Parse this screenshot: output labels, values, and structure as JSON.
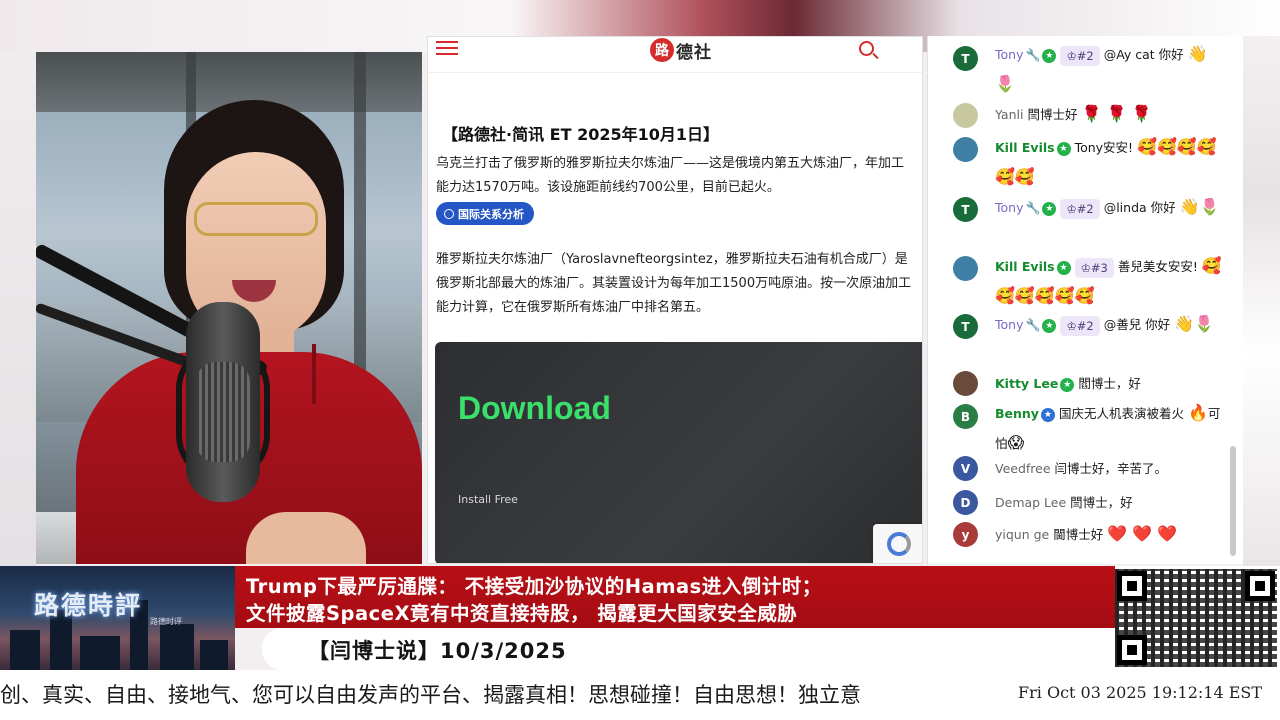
{
  "article": {
    "logo_text": "德社",
    "logo_badge": "路",
    "title": "【路德社·简讯 ET 2025年10月1日】",
    "paragraph1": "乌克兰打击了俄罗斯的雅罗斯拉夫尔炼油厂——这是俄境内第五大炼油厂，年加工能力达1570万吨。该设施距前线约700公里，目前已起火。",
    "tag": "国际关系分析",
    "paragraph2": "雅罗斯拉夫尔炼油厂（Yaroslavnefteorgsintez，雅罗斯拉夫石油有机合成厂）是俄罗斯北部最大的炼油厂。其装置设计为每年加工1500万吨原油。按一次原油加工能力计算，它在俄罗斯所有炼油厂中排名第五。",
    "ad": {
      "headline": "Download",
      "sub": "Install Free"
    }
  },
  "chat": {
    "messages": [
      {
        "avatar": "T",
        "avatar_color": "#1a6b3a",
        "user": "Tony",
        "rank": "♔#2",
        "text": "@Ay cat 你好",
        "emoji": "👋🌷"
      },
      {
        "avatar": "",
        "avatar_color": "#c8c8a0",
        "user": "Yanli",
        "text": "閆博士好",
        "emoji": "🌹 🌹 🌹"
      },
      {
        "avatar": "",
        "avatar_color": "#3f7fa6",
        "user": "Kill Evils",
        "text": "Tony安安!",
        "emoji": "🥰🥰🥰🥰🥰🥰"
      },
      {
        "avatar": "T",
        "avatar_color": "#1a6b3a",
        "user": "Tony",
        "rank": "♔#2",
        "text": "@linda 你好",
        "emoji": "👋🌷"
      },
      {
        "avatar": "",
        "avatar_color": "#3f7fa6",
        "user": "Kill Evils",
        "rank": "♔#3",
        "text": "善兒美女安安!",
        "emoji": "🥰🥰🥰🥰🥰🥰"
      },
      {
        "avatar": "T",
        "avatar_color": "#1a6b3a",
        "user": "Tony",
        "rank": "♔#2",
        "text": "@善兒 你好",
        "emoji": "👋🌷"
      },
      {
        "avatar": "",
        "avatar_color": "#6a4a3a",
        "user": "Kitty Lee",
        "text": "閻博士，好"
      },
      {
        "avatar": "B",
        "avatar_color": "#2b7d46",
        "user": "Benny",
        "text": "国庆无人机表演被着火",
        "text2": "可怕",
        "emoji": "🔥",
        "emoji2": "😱"
      },
      {
        "avatar": "V",
        "avatar_color": "#3a57a0",
        "user": "Veedfree",
        "text": "闫博士好，辛苦了。"
      },
      {
        "avatar": "D",
        "avatar_color": "#3a57a0",
        "user": "Demap Lee",
        "text": "閆博士，好"
      },
      {
        "avatar": "y",
        "avatar_color": "#a83a3a",
        "user": "yiqun ge",
        "text": "閫博士好",
        "emoji": "❤️ ❤️ ❤️"
      }
    ]
  },
  "banner": {
    "channel": "路德時評",
    "channel_sub": "路德时评",
    "headline1": "Trump下最严厉通牒： 不接受加沙协议的Hamas进入倒计时；",
    "headline2": "文件披露SpaceX竟有中资直接持股， 揭露更大国家安全威胁",
    "show": "【闫博士说】10/3/2025"
  },
  "ticker": {
    "text": "创、真实、自由、接地气、您可以自由发声的平台、揭露真相！思想碰撞！自由思想！独立意",
    "clock": "Fri Oct 03 2025 19:12:14 EST"
  }
}
